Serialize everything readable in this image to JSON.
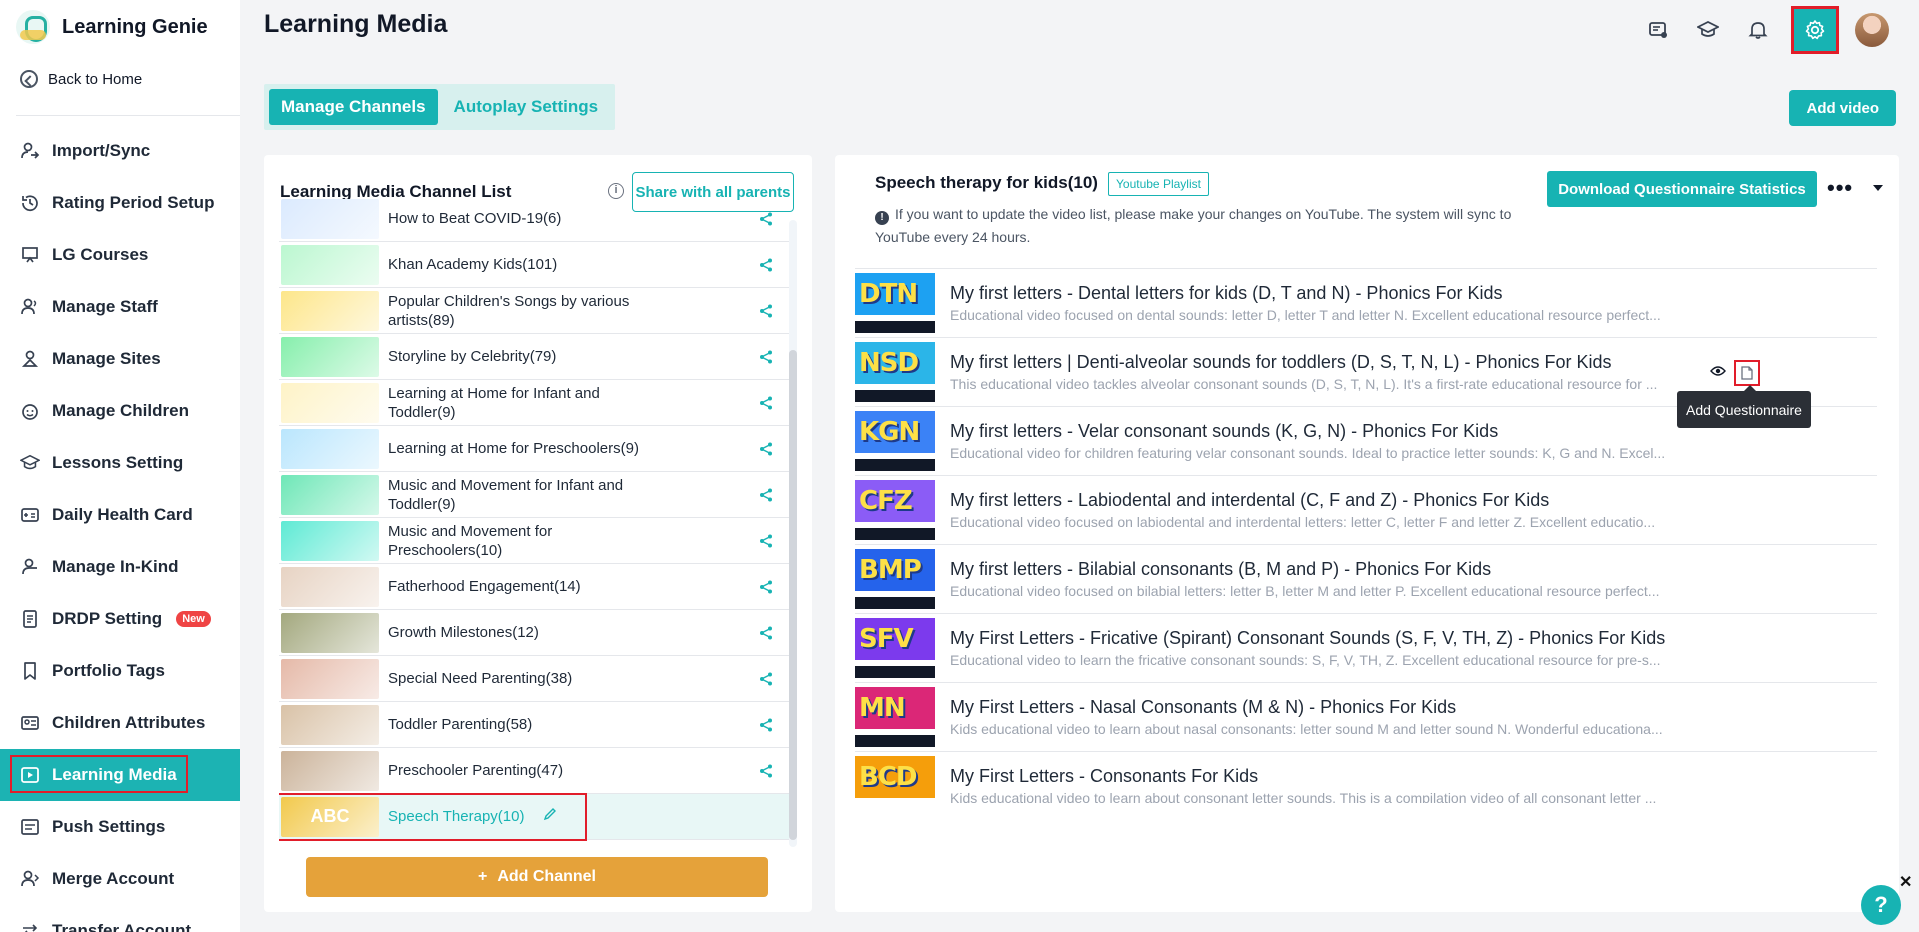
{
  "app": {
    "name": "Learning Genie",
    "back_label": "Back to Home"
  },
  "sidebar": {
    "items": [
      {
        "label": "Import/Sync",
        "icon": "sync-user-icon"
      },
      {
        "label": "Rating Period Setup",
        "icon": "history-icon"
      },
      {
        "label": "LG Courses",
        "icon": "presentation-icon"
      },
      {
        "label": "Manage Staff",
        "icon": "staff-icon"
      },
      {
        "label": "Manage Sites",
        "icon": "sites-icon"
      },
      {
        "label": "Manage Children",
        "icon": "child-face-icon"
      },
      {
        "label": "Lessons Setting",
        "icon": "graduation-cap-icon"
      },
      {
        "label": "Daily Health Card",
        "icon": "health-card-icon"
      },
      {
        "label": "Manage In-Kind",
        "icon": "in-kind-icon"
      },
      {
        "label": "DRDP Setting",
        "icon": "drdp-icon",
        "badge": "New"
      },
      {
        "label": "Portfolio Tags",
        "icon": "bookmark-icon"
      },
      {
        "label": "Children Attributes",
        "icon": "id-card-icon"
      },
      {
        "label": "Learning Media",
        "icon": "play-icon",
        "active": true
      },
      {
        "label": "Push Settings",
        "icon": "push-icon"
      },
      {
        "label": "Merge Account",
        "icon": "merge-icon"
      },
      {
        "label": "Transfer Account",
        "icon": "transfer-icon"
      }
    ]
  },
  "header": {
    "title": "Learning Media"
  },
  "tabs": {
    "manage": "Manage Channels",
    "autoplay": "Autoplay Settings"
  },
  "toolbar": {
    "add_video": "Add video"
  },
  "channel_panel": {
    "title": "Learning Media Channel List",
    "info": "i",
    "share_all": "Share with all parents",
    "add_channel": "Add Channel",
    "channels": [
      {
        "name": "How to Beat COVID-19(6)",
        "color": "#dbeafe"
      },
      {
        "name": "Khan Academy Kids(101)",
        "color": "#bbf7d0"
      },
      {
        "name": "Popular Children's Songs by various artists(89)",
        "color": "#fde68a"
      },
      {
        "name": "Storyline by Celebrity(79)",
        "color": "#86efac"
      },
      {
        "name": "Learning at Home for Infant and Toddler(9)",
        "color": "#fef3c7"
      },
      {
        "name": "Learning at Home for Preschoolers(9)",
        "color": "#bae6fd"
      },
      {
        "name": "Music and Movement for Infant and Toddler(9)",
        "color": "#6ee7b7"
      },
      {
        "name": "Music and Movement for Preschoolers(10)",
        "color": "#5eead4"
      },
      {
        "name": "Fatherhood Engagement(14)",
        "color": "#e7d3c3"
      },
      {
        "name": "Growth Milestones(12)",
        "color": "#a3a87e"
      },
      {
        "name": "Special Need Parenting(38)",
        "color": "#e5b9a8"
      },
      {
        "name": "Toddler Parenting(58)",
        "color": "#d9c2a7"
      },
      {
        "name": "Preschooler Parenting(47)",
        "color": "#cbb39a"
      },
      {
        "name": "Speech Therapy(10)",
        "color": "#f2c94c",
        "active": true,
        "thumb_text": "ABC"
      }
    ]
  },
  "video_panel": {
    "title": "Speech therapy for kids(10)",
    "tag": "Youtube Playlist",
    "notice": "If you want to update the video list, please make your changes on YouTube. The system will sync to YouTube every 24 hours.",
    "download_btn": "Download Questionnaire Statistics",
    "more": "•••",
    "tooltip": "Add Questionnaire",
    "videos": [
      {
        "title": "My first letters - Dental letters for kids (D, T and N) - Phonics For Kids",
        "desc": "Educational video focused on dental sounds: letter D, letter T and letter N. Excellent educational resource perfect...",
        "letters": "DTN",
        "bg": "#1da1f2"
      },
      {
        "title": "My first letters | Denti-alveolar sounds for toddlers (D, S, T, N, L) - Phonics For Kids",
        "desc": "This educational video tackles alveolar consonant sounds (D, S, T, N, L). It's a first-rate educational resource for ...",
        "letters": "NSD",
        "bg": "#2bb5e8",
        "hover": true
      },
      {
        "title": "My first letters - Velar consonant sounds (K, G, N) - Phonics For Kids",
        "desc": "Educational video for children featuring velar consonant sounds. Ideal to practice letter sounds: K, G and N. Excel...",
        "letters": "KGN",
        "bg": "#3b82f6"
      },
      {
        "title": "My first letters - Labiodental and interdental (C, F and Z) - Phonics For Kids",
        "desc": "Educational video focused on labiodental and interdental letters: letter C, letter F and letter Z. Excellent educatio...",
        "letters": "CFZ",
        "bg": "#8b5cf6"
      },
      {
        "title": "My first letters - Bilabial consonants (B, M and P) - Phonics For Kids",
        "desc": "Educational video focused on bilabial letters: letter B, letter M and letter P. Excellent educational resource perfect...",
        "letters": "BMP",
        "bg": "#2563eb"
      },
      {
        "title": "My First Letters - Fricative (Spirant) Consonant Sounds (S, F, V, TH, Z) - Phonics For Kids",
        "desc": "Educational video to learn the fricative consonant sounds: S, F, V, TH, Z. Excellent educational resource for pre-s...",
        "letters": "SFV",
        "bg": "#7c3aed"
      },
      {
        "title": "My First Letters - Nasal Consonants (M & N) - Phonics For Kids",
        "desc": "Kids educational video to learn about nasal consonants: letter sound M and letter sound N. Wonderful educationa...",
        "letters": "MN",
        "bg": "#db2777"
      },
      {
        "title": "My First Letters - Consonants For Kids",
        "desc": "Kids educational video to learn about consonant letter sounds. This is a compilation video of all consonant letter ...",
        "letters": "BCD",
        "bg": "#f59e0b"
      }
    ]
  },
  "help": {
    "label": "?"
  },
  "close": {
    "label": "✕"
  },
  "colors": {
    "accent": "#17b3b3",
    "highlight": "#e11d2a",
    "orange": "#e5a23a"
  }
}
